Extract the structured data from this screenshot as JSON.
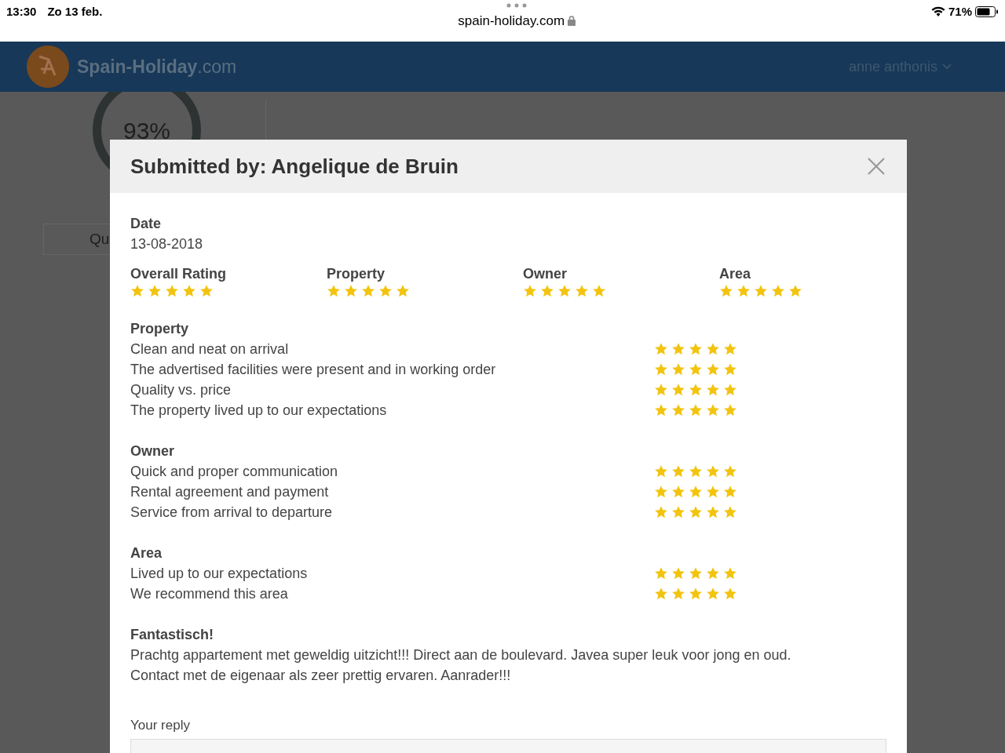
{
  "status_bar": {
    "time": "13:30",
    "date": "Zo 13 feb.",
    "url": "spain-holiday.com",
    "battery": "71%"
  },
  "header": {
    "logo_name": "Spain-Holiday",
    "logo_suffix": ".com",
    "user": "anne anthonis"
  },
  "background": {
    "score": "93%",
    "tab": "Qu"
  },
  "modal": {
    "title": "Submitted by: Angelique de Bruin",
    "date_label": "Date",
    "date": "13-08-2018",
    "ratings": [
      {
        "label": "Overall Rating",
        "stars": 5
      },
      {
        "label": "Property",
        "stars": 5
      },
      {
        "label": "Owner",
        "stars": 5
      },
      {
        "label": "Area",
        "stars": 5
      }
    ],
    "sections": [
      {
        "title": "Property",
        "items": [
          {
            "label": "Clean and neat on arrival",
            "stars": 5
          },
          {
            "label": "The advertised facilities were present and in working order",
            "stars": 5
          },
          {
            "label": "Quality vs. price",
            "stars": 5
          },
          {
            "label": "The property lived up to our expectations",
            "stars": 5
          }
        ]
      },
      {
        "title": "Owner",
        "items": [
          {
            "label": "Quick and proper communication",
            "stars": 5
          },
          {
            "label": "Rental agreement and payment",
            "stars": 5
          },
          {
            "label": "Service from arrival to departure",
            "stars": 5
          }
        ]
      },
      {
        "title": "Area",
        "items": [
          {
            "label": "Lived up to our expectations",
            "stars": 5
          },
          {
            "label": "We recommend this area",
            "stars": 5
          }
        ]
      }
    ],
    "review": {
      "title": "Fantastisch!",
      "text": "Prachtg appartement met geweldig uitzicht!!! Direct aan de boulevard. Javea super leuk voor jong en oud. Contact met de eigenaar als zeer prettig ervaren. Aanrader!!!"
    },
    "reply": {
      "label": "Your reply"
    }
  }
}
